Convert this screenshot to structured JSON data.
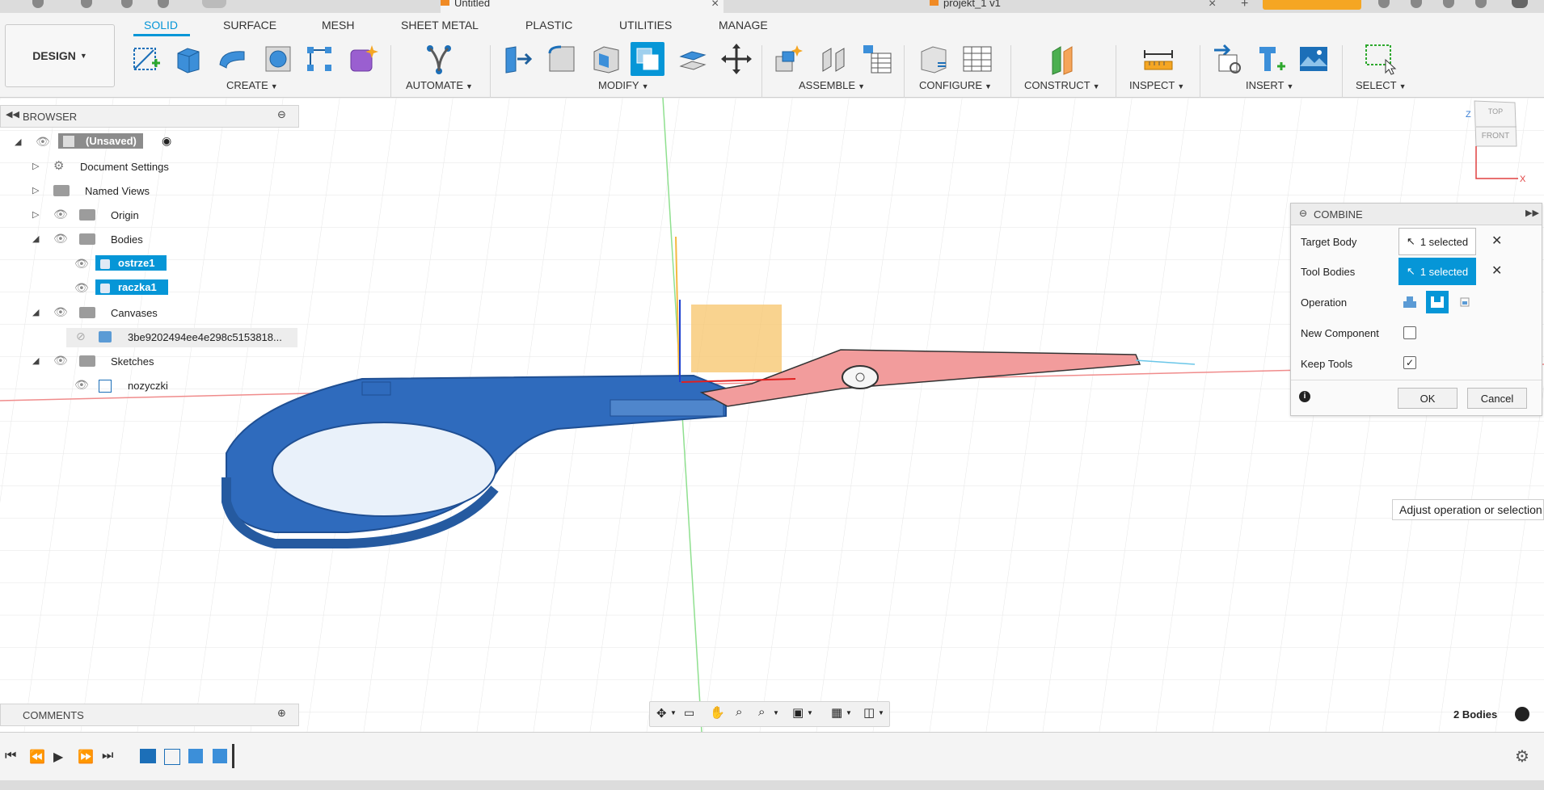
{
  "titlebar": {
    "tab1": "Untitled",
    "tab2": "projekt_1 v1"
  },
  "design_button": "DESIGN",
  "tabs": [
    "SOLID",
    "SURFACE",
    "MESH",
    "SHEET METAL",
    "PLASTIC",
    "UTILITIES",
    "MANAGE"
  ],
  "groups": {
    "create": "CREATE",
    "automate": "AUTOMATE",
    "modify": "MODIFY",
    "assemble": "ASSEMBLE",
    "configure": "CONFIGURE",
    "construct": "CONSTRUCT",
    "inspect": "INSPECT",
    "insert": "INSERT",
    "select": "SELECT"
  },
  "browser": {
    "title": "BROWSER",
    "root": "(Unsaved)",
    "document_settings": "Document Settings",
    "named_views": "Named Views",
    "origin": "Origin",
    "bodies": "Bodies",
    "body1": "ostrze1",
    "body2": "raczka1",
    "canvases": "Canvases",
    "canvas1": "3be9202494ee4e298c5153818...",
    "sketches": "Sketches",
    "sketch1": "nozyczki"
  },
  "combine": {
    "title": "COMBINE",
    "target_body_label": "Target Body",
    "target_body_value": "1 selected",
    "tool_bodies_label": "Tool Bodies",
    "tool_bodies_value": "1 selected",
    "operation_label": "Operation",
    "new_component_label": "New Component",
    "new_component_checked": false,
    "keep_tools_label": "Keep Tools",
    "keep_tools_checked": true,
    "ok_label": "OK",
    "cancel_label": "Cancel"
  },
  "tooltip": "Adjust operation or selection",
  "viewcube": {
    "top": "TOP",
    "front": "FRONT",
    "axis_z": "Z",
    "axis_x": "X"
  },
  "comments": {
    "title": "COMMENTS"
  },
  "status": {
    "bodies_count": "2 Bodies"
  },
  "colors": {
    "accent": "#0696d7",
    "body_blue": "#2f6bbd",
    "body_red": "#f29c9c",
    "sketch_yellow": "#f7c46a"
  }
}
